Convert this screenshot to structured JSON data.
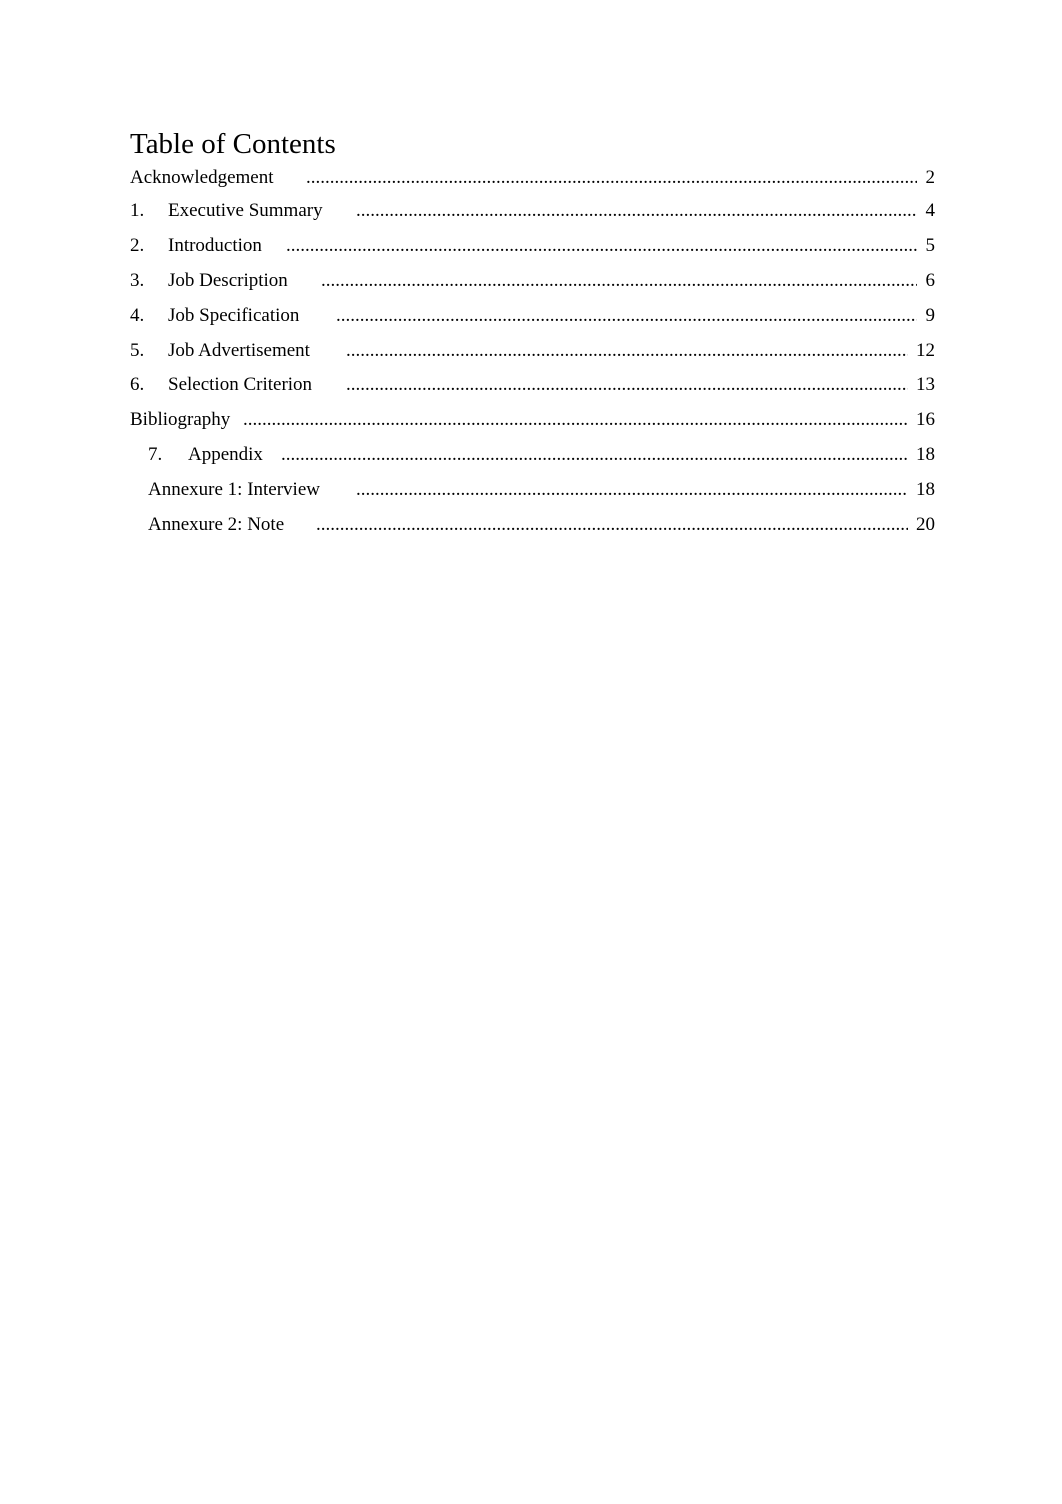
{
  "document": {
    "title": "Table of Contents",
    "entries": [
      {
        "number": "",
        "label": "Acknowledgement",
        "page": "2"
      },
      {
        "number": "1.",
        "label": "Executive Summary",
        "page": "4"
      },
      {
        "number": "2.",
        "label": "Introduction",
        "page": "5"
      },
      {
        "number": "3.",
        "label": "Job Description",
        "page": "6"
      },
      {
        "number": "4.",
        "label": "Job Specification",
        "page": "9"
      },
      {
        "number": "5.",
        "label": "Job Advertisement",
        "page": "12"
      },
      {
        "number": "6.",
        "label": "Selection Criterion",
        "page": "13"
      },
      {
        "number": "",
        "label": "Bibliography",
        "page": "16"
      },
      {
        "number": "7.",
        "label": "Appendix",
        "page": "18"
      },
      {
        "number": "",
        "label": "Annexure 1: Interview",
        "page": "18"
      },
      {
        "number": "",
        "label": "Annexure 2: Note",
        "page": "20"
      }
    ]
  }
}
